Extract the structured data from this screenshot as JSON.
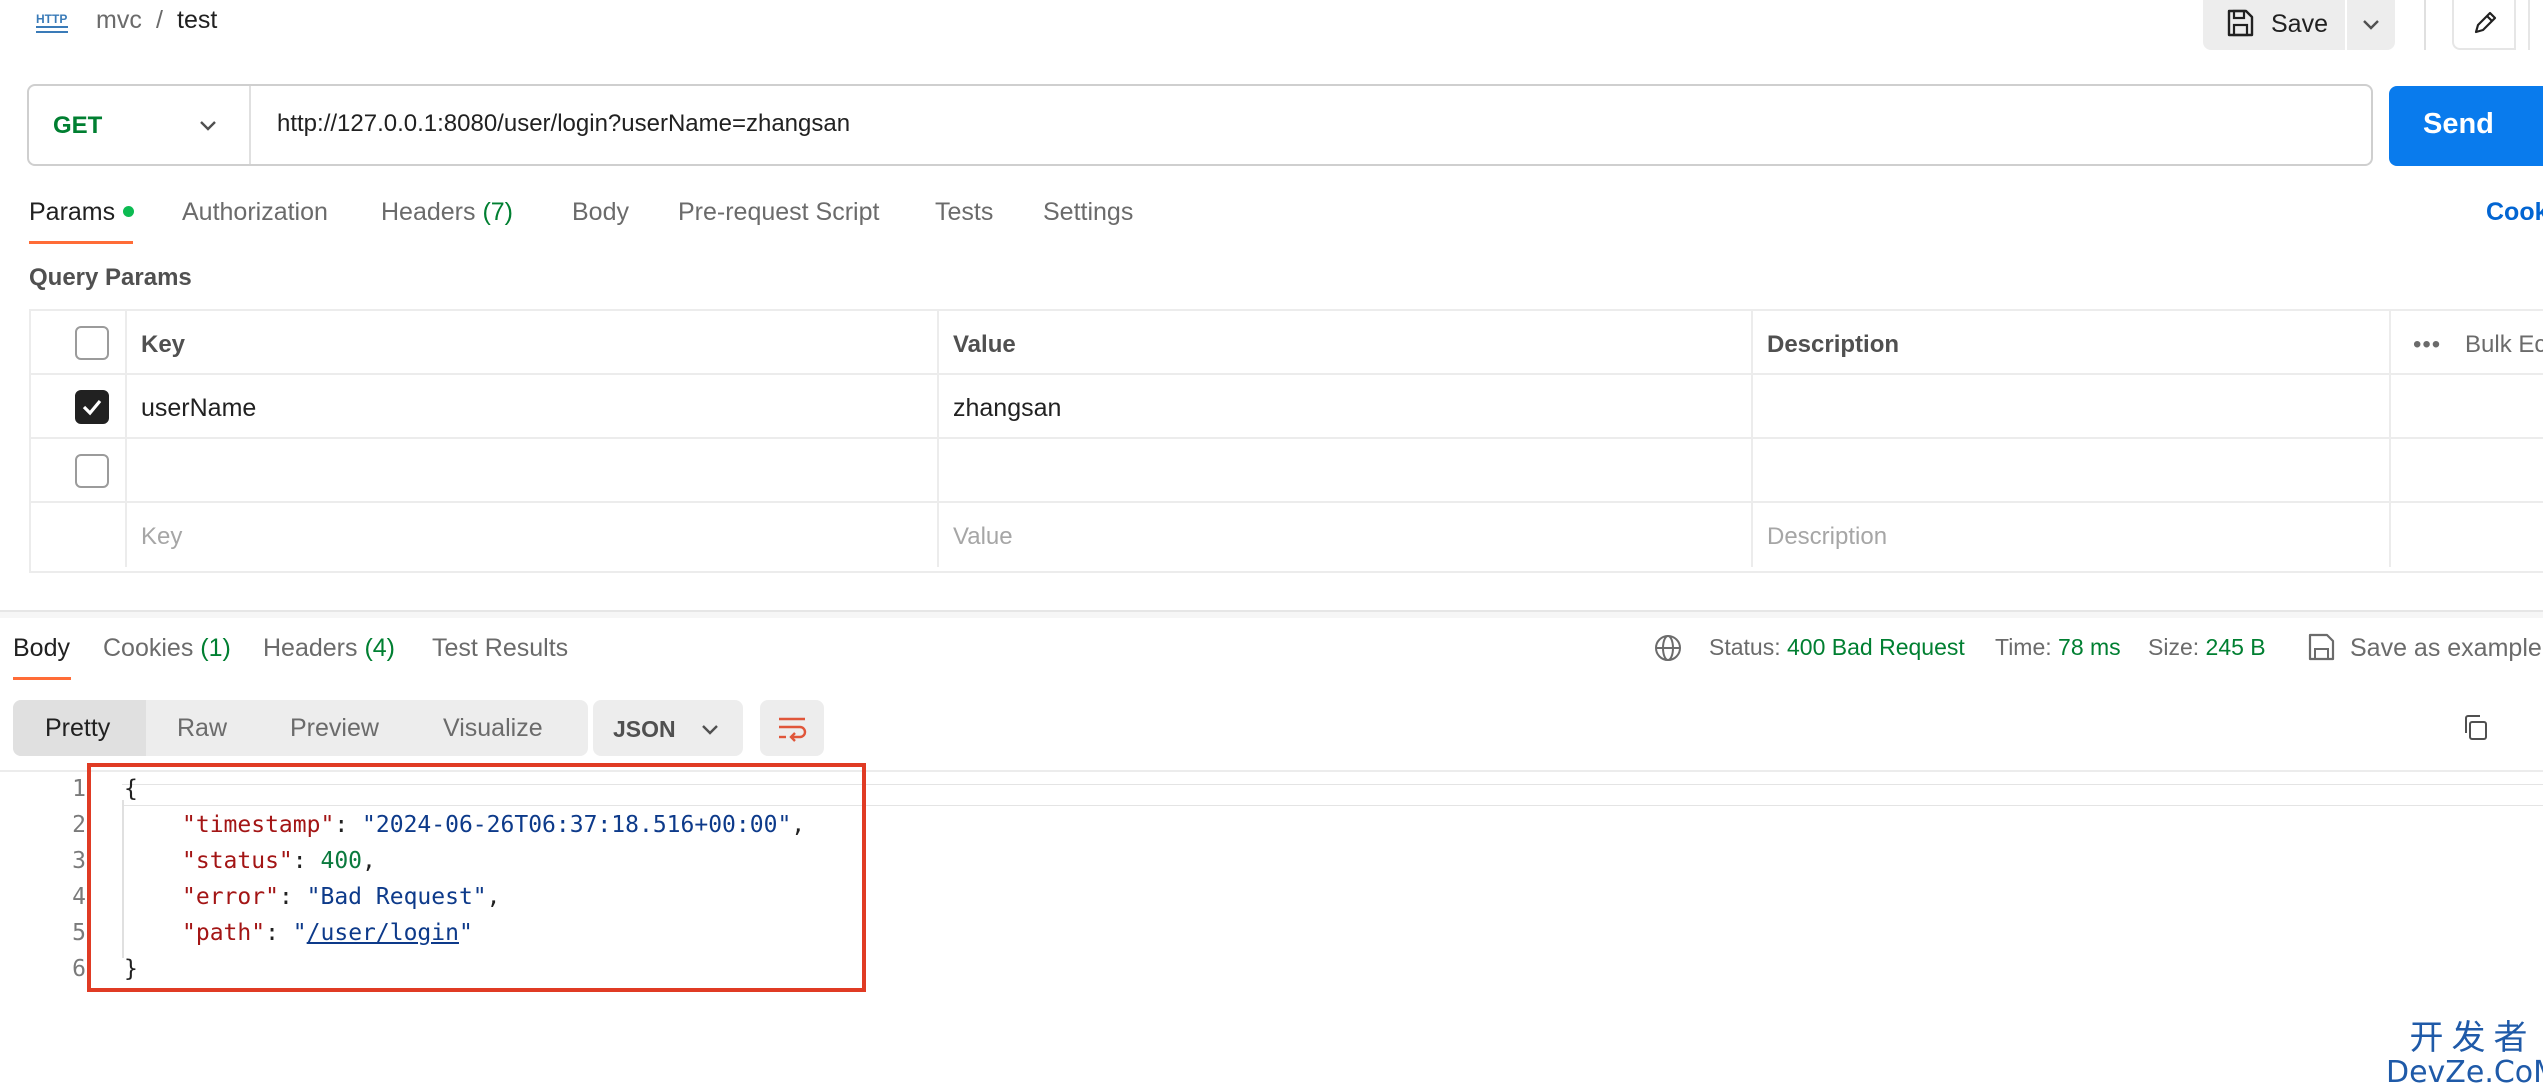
{
  "breadcrumb": {
    "icon": "http-request-icon",
    "parent": "mvc",
    "separator": "/",
    "current": "test"
  },
  "toolbar": {
    "save_label": "Save"
  },
  "request": {
    "method": "GET",
    "url": "http://127.0.0.1:8080/user/login?userName=zhangsan",
    "send_label": "Send"
  },
  "request_tabs": {
    "params": "Params",
    "authorization": "Authorization",
    "headers": "Headers",
    "headers_count": "(7)",
    "body": "Body",
    "pre_request": "Pre-request Script",
    "tests": "Tests",
    "settings": "Settings",
    "cookies": "Cook"
  },
  "query_params": {
    "title": "Query Params",
    "headers": {
      "key": "Key",
      "value": "Value",
      "description": "Description",
      "bulk": "Bulk Ec"
    },
    "rows": [
      {
        "checked": true,
        "key": "userName",
        "value": "zhangsan",
        "description": ""
      },
      {
        "checked": false,
        "key": "",
        "value": "",
        "description": ""
      }
    ],
    "placeholders": {
      "key": "Key",
      "value": "Value",
      "description": "Description"
    }
  },
  "response_tabs": {
    "body": "Body",
    "cookies": "Cookies",
    "cookies_count": "(1)",
    "headers": "Headers",
    "headers_count": "(4)",
    "test_results": "Test Results"
  },
  "response_meta": {
    "status_label": "Status:",
    "status_value": "400 Bad Request",
    "time_label": "Time:",
    "time_value": "78 ms",
    "size_label": "Size:",
    "size_value": "245 B",
    "save_example": "Save as example"
  },
  "view_options": {
    "pretty": "Pretty",
    "raw": "Raw",
    "preview": "Preview",
    "visualize": "Visualize",
    "format": "JSON"
  },
  "response_body": {
    "line_numbers": [
      "1",
      "2",
      "3",
      "4",
      "5",
      "6"
    ],
    "open_brace": "{",
    "close_brace": "}",
    "fields": [
      {
        "key": "\"timestamp\"",
        "sep": ": ",
        "value": "\"2024-06-26T06:37:18.516+00:00\"",
        "trail": ","
      },
      {
        "key": "\"status\"",
        "sep": ": ",
        "value": "400",
        "trail": ","
      },
      {
        "key": "\"error\"",
        "sep": ": ",
        "value": "\"Bad Request\"",
        "trail": ","
      },
      {
        "key": "\"path\"",
        "sep": ": ",
        "quote": "\"",
        "value": "/user/login",
        "trail": "\""
      }
    ]
  },
  "watermark": {
    "cn": "开发者",
    "en": "DevZe.CoM"
  },
  "colors": {
    "accent_orange": "#ff6c37",
    "send_blue": "#097bed",
    "method_green": "#007f31",
    "highlight_red": "#e03b24"
  }
}
